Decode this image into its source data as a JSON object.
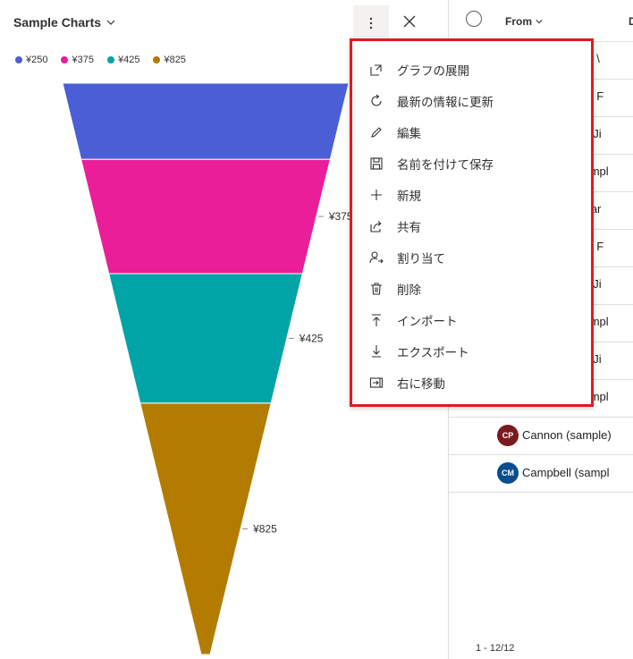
{
  "chart": {
    "title": "Sample Charts"
  },
  "colors": {
    "series": [
      "#4a5fd6",
      "#e91e98",
      "#00a4a6",
      "#b37c00"
    ],
    "menu_border": "#e3191c"
  },
  "chart_data": {
    "type": "funnel",
    "categories": [
      "¥250",
      "¥375",
      "¥425",
      "¥825"
    ],
    "values": [
      250,
      375,
      425,
      825
    ],
    "legend_position": "top-left",
    "data_labels": [
      "",
      "¥375",
      "¥425",
      "¥825"
    ]
  },
  "menu": {
    "items": [
      {
        "label": "グラフの展開",
        "icon": "expand-icon"
      },
      {
        "label": "最新の情報に更新",
        "icon": "refresh-icon"
      },
      {
        "label": "編集",
        "icon": "edit-icon"
      },
      {
        "label": "名前を付けて保存",
        "icon": "save-icon"
      },
      {
        "label": "新規",
        "icon": "add-icon"
      },
      {
        "label": "共有",
        "icon": "share-icon"
      },
      {
        "label": "割り当て",
        "icon": "assign-icon"
      },
      {
        "label": "削除",
        "icon": "delete-icon"
      },
      {
        "label": "インポート",
        "icon": "import-icon"
      },
      {
        "label": "エクスポート",
        "icon": "export-icon"
      },
      {
        "label": "右に移動",
        "icon": "move-right-icon"
      }
    ]
  },
  "grid": {
    "column_from": "From",
    "column_d": "D",
    "partial_rows": [
      "ple) \\",
      "ple) F",
      "ple) Ji",
      "sampl",
      "(sar",
      "ple) F",
      "ple) Ji",
      "sampl",
      "ple) Ji",
      "sampl"
    ],
    "rows": [
      {
        "initials": "CP",
        "name": "Cannon (sample)",
        "color": "#7a1a1e"
      },
      {
        "initials": "CM",
        "name": "Campbell (sampl",
        "color": "#0a4d8c"
      }
    ],
    "pager": "1 - 12/12"
  }
}
